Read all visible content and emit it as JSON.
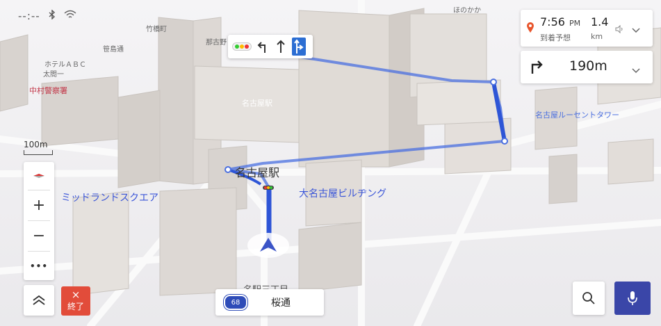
{
  "status_bar": {
    "time": "--:--"
  },
  "eta": {
    "time": "7:56",
    "ampm": "PM",
    "label": "到着予想",
    "distance": "1.4",
    "unit": "km"
  },
  "next_turn": {
    "distance": "190m"
  },
  "map_labels": {
    "nagoya_station": "名古屋駅",
    "nagoya_station_small": "名古屋駅",
    "midland_square": "ミッドランドスクエア",
    "dai_nagoya_building": "大名古屋ビルヂング",
    "lucent_tower": "名古屋ルーセントタワー",
    "hotel_abc": "ホテルＡＢＣ",
    "taiko": "太閤一",
    "nakamura_police": "中村警察署",
    "sasashima": "笹島通",
    "bottom_street": "名駅三丁目",
    "street_top1": "竹橋町",
    "street_top2": "那古野",
    "street_top3": "ほのかか"
  },
  "zoom_panel": {
    "plus": "+",
    "minus": "−",
    "more": "•••"
  },
  "scale": {
    "label": "100m"
  },
  "end_button": {
    "label": "終了",
    "icon": "×"
  },
  "road_info": {
    "route_number": "68",
    "name": "桜通"
  },
  "colors": {
    "route": "#4a6fe0",
    "accent": "#3a46a8",
    "end": "#e24c3a",
    "nav_arrow": "#3b54c7"
  }
}
